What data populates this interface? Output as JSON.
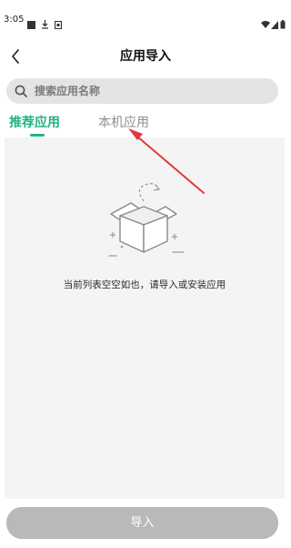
{
  "status_bar": {
    "time": "3:05",
    "icons": [
      "notification-square-icon",
      "download-icon",
      "sim-card-icon",
      "wifi-icon",
      "signal-icon",
      "battery-icon"
    ]
  },
  "header": {
    "title": "应用导入",
    "back_icon": "chevron-left-icon"
  },
  "search": {
    "placeholder": "搜索应用名称",
    "icon": "search-icon"
  },
  "tabs": [
    {
      "label": "推荐应用",
      "active": true
    },
    {
      "label": "本机应用",
      "active": false
    }
  ],
  "empty_state": {
    "icon": "empty-box-icon",
    "message": "当前列表空空如也，请导入或安装应用"
  },
  "footer": {
    "import_label": "导入"
  },
  "colors": {
    "accent": "#1eb384",
    "inactive_tab": "#8f8f8f",
    "button_disabled": "#b9b9b9",
    "content_bg": "#f4f4f4",
    "search_bg": "#e4e4e4",
    "annotation_arrow": "#e0393e"
  }
}
